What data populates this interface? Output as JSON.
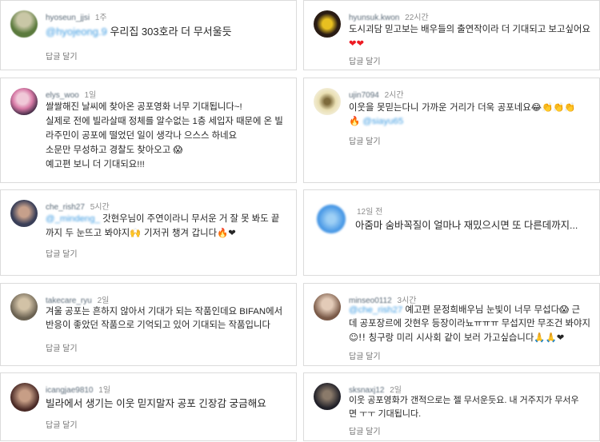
{
  "reply_label": "답글 달기",
  "comments": [
    {
      "user": "hyoseun_jjsi",
      "time": "1주",
      "mention": "@hyojeong.9",
      "lines": [
        "우리집 303호라 더 무서울듯"
      ],
      "avatar_colors": [
        "#5b7a3d",
        "#c9c7a6"
      ]
    },
    {
      "user": "hyunsuk.kwon",
      "time": "22시간",
      "lines": [
        "도시괴담 믿고보는 배우들의 출연작이라 더 기대되고 보고싶어요"
      ],
      "trail": "❤❤",
      "avatar_colors": [
        "#2a1c14",
        "#e8c020"
      ]
    },
    {
      "user": "elys_woo",
      "time": "1일",
      "lines": [
        "쌀쌀해진 날씨에 찾아온 공포영화 너무 기대됩니다~!",
        "실제로 전에 빌라살때 정체를 알수없는 1층 세입자 때문에 온 빌",
        "라주민이 공포에 떨었던 일이 생각나 으스스 하네요",
        "소문만 무성하고 경찰도 찾아오고 😱",
        "예고편 보니 더 기대되요!!!"
      ],
      "avatar_colors": [
        "#d77aa6",
        "#3a2740"
      ]
    },
    {
      "user": "ujin7094",
      "time": "2시간",
      "lines": [
        "이웃을 못믿는다니 가까운 거리가 더욱 공포네요😂👏👏👏"
      ],
      "pre2": "🔥",
      "mention2": "@siayu65",
      "avatar_colors": [
        "#e9dfb3",
        "#7d6a3b"
      ]
    },
    {
      "user": "che_rish27",
      "time": "5시간",
      "mention": "@_mindeng_",
      "lines": [
        "갓현우님이 주연이라니 무서운 거 잘 못 봐도 끝",
        "까지 두 눈뜨고 봐야지🙌 기저귀 챙겨 갑니다🔥❤"
      ],
      "avatar_colors": [
        "#3a3f58",
        "#c7a08b"
      ]
    },
    {
      "user": "",
      "time": "12일 전",
      "lines": [
        "아줌마 숨바꼭질이 얼마나 재밌으시면 또 다른데까지..."
      ],
      "avatar_colors": [
        "#3a8fe3",
        "#9fd0f5"
      ]
    },
    {
      "user": "takecare_ryu",
      "time": "2일",
      "lines": [
        "겨울 공포는 흔하지 않아서 기대가 되는 작품인데요 BIFAN에서",
        "반응이 좋았던 작품으로 기억되고 있어 기대되는 작품입니다"
      ],
      "avatar_colors": [
        "#6b6252",
        "#d2c2a6"
      ]
    },
    {
      "user": "minseo0112",
      "time": "3시간",
      "mention": "@che_rish27",
      "lines": [
        "예고편 문정희배우님 눈빛이 너무 무섭다😱 근",
        "데 공포장르에 갓현우 등장이라뇨ㅠㅠㅠ 무섭지만 무조건 봐야지",
        "☺!! 칭구랑 미리 시사회 같이 보러 가고싶습니다🙏🙏❤"
      ],
      "avatar_colors": [
        "#7a5a48",
        "#e3cbb8"
      ]
    },
    {
      "user": "icangjae9810",
      "time": "1일",
      "lines": [
        "빌라에서 생기는 이웃 믿지말자 공포 긴장감 궁금해요"
      ],
      "avatar_colors": [
        "#4a2a26",
        "#c79e86"
      ]
    },
    {
      "user": "sksnaxj12",
      "time": "2일",
      "lines": [
        "이웃 공포영화가 갠적으로는 젤 무서운듯요.  내 거주지가 무서우",
        "면 ㅜㅜ 기대됩니다."
      ],
      "avatar_colors": [
        "#202028",
        "#8a7a6a"
      ]
    }
  ]
}
